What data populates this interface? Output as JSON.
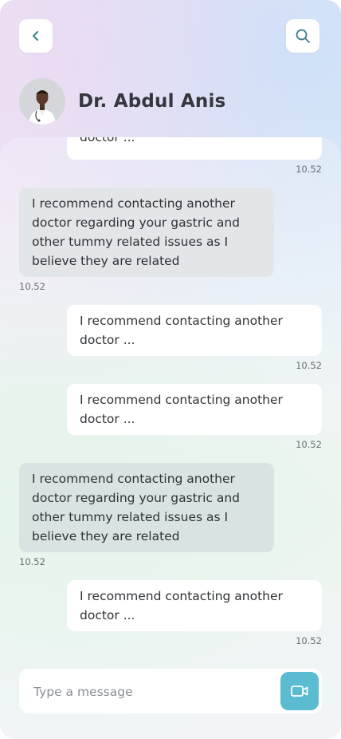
{
  "header": {
    "back_icon": "chevron-left-icon",
    "search_icon": "search-icon",
    "doctor_name": "Dr. Abdul Anis"
  },
  "messages": [
    {
      "sender": "me",
      "text": "doctor ...",
      "time": "10.52"
    },
    {
      "sender": "doctor",
      "text": "I recommend contacting another doctor regarding your gastric and other tummy related issues as I believe they are related",
      "time": "10.52"
    },
    {
      "sender": "me",
      "text": "I recommend contacting another doctor ...",
      "time": "10.52"
    },
    {
      "sender": "me",
      "text": "I recommend contacting another doctor ...",
      "time": "10.52"
    },
    {
      "sender": "doctor",
      "text": "I recommend contacting another doctor regarding your gastric and other tummy related issues as I believe they are related",
      "time": "10.52"
    },
    {
      "sender": "me",
      "text": "I recommend contacting another doctor ...",
      "time": "10.52"
    }
  ],
  "composer": {
    "placeholder": "Type a message",
    "video_icon": "video-camera-icon"
  },
  "colors": {
    "accent": "#5bbcd1",
    "doctor_bubble": "#e3e6e8",
    "user_bubble": "#ffffff",
    "text": "#2f3236"
  }
}
